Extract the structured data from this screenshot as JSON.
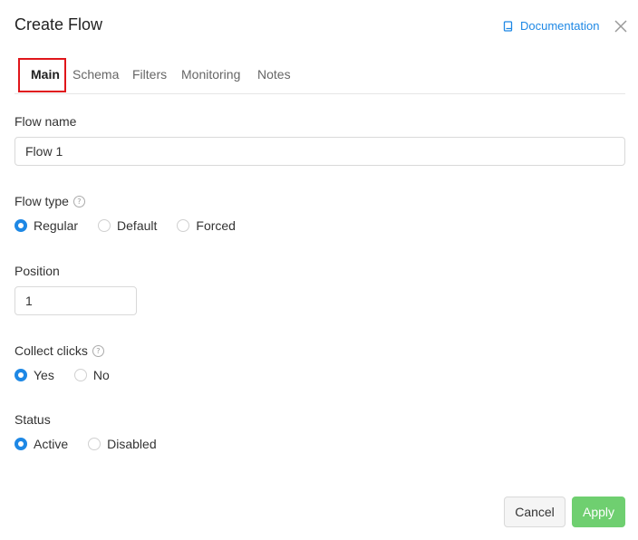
{
  "dialog": {
    "title": "Create Flow",
    "documentation_label": "Documentation",
    "close_icon": "close-icon"
  },
  "tabs": [
    {
      "label": "Main",
      "active": true
    },
    {
      "label": "Schema",
      "active": false
    },
    {
      "label": "Filters",
      "active": false
    },
    {
      "label": "Monitoring",
      "active": false
    },
    {
      "label": "Notes",
      "active": false
    }
  ],
  "form": {
    "flow_name": {
      "label": "Flow name",
      "value": "Flow 1"
    },
    "flow_type": {
      "label": "Flow type",
      "options": [
        "Regular",
        "Default",
        "Forced"
      ],
      "selected": "Regular"
    },
    "position": {
      "label": "Position",
      "value": "1"
    },
    "collect_clicks": {
      "label": "Collect clicks",
      "options": [
        "Yes",
        "No"
      ],
      "selected": "Yes"
    },
    "status": {
      "label": "Status",
      "options": [
        "Active",
        "Disabled"
      ],
      "selected": "Active"
    }
  },
  "footer": {
    "cancel_label": "Cancel",
    "apply_label": "Apply"
  },
  "colors": {
    "accent": "#1e88e5",
    "apply": "#6fcf70",
    "highlight": "#e0161b"
  }
}
